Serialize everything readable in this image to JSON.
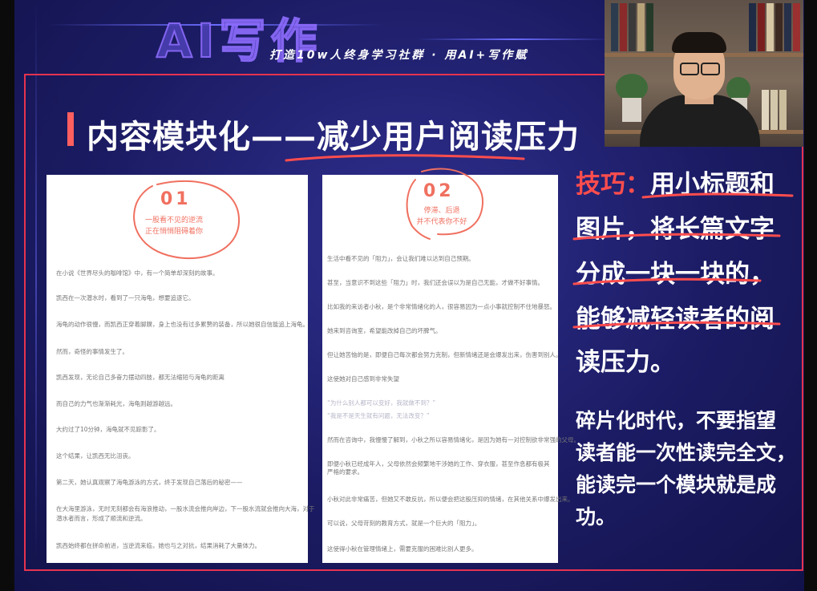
{
  "header": {
    "logo_text": "AI写作",
    "slogan": "打造10w人终身学习社群 · 用AI+写作赋"
  },
  "slide": {
    "title": "内容模块化——减少用户阅读压力",
    "cards": [
      {
        "number": "01",
        "badge_line1": "一股看不见的逆流",
        "badge_line2": "正在悄悄阻碍着你",
        "paragraphs": [
          "在小说《世界尽头的咖啡馆》中，有一个简单却深刻的故事。",
          "凯西在一次潜水时，看到了一只海龟，想要追逐它。",
          "海龟的动作很慢，而凯西正穿着脚蹼，身上也没有过多累赘的装备，所以她很自信能追上海龟。",
          "然而，奇怪的事情发生了。",
          "凯西发现，无论自己多奋力摆动四肢，都无法缩短与海龟的距离",
          "而自己的力气也渐渐耗光，海龟则越游越远。",
          "大约过了10分钟，海龟就不见踪影了。",
          "这个结果，让凯西无比沮丧。",
          "第二天，她认真观察了海龟游泳的方式，终于发现自己落后的秘密——",
          "在大海里游泳，无时无刻都会有海浪推动，一股水流会推向岸边，下一股水流就会推向大海，对于",
          "潜水者而言，形成了顺流和逆流。",
          "凯西始终都在拼命前进，当逆流来临，她也与之对抗，结果消耗了大量体力。"
        ]
      },
      {
        "number": "02",
        "badge_line1": "停滞、后退",
        "badge_line2": "并不代表你不好",
        "paragraphs": [
          "生活中看不见的「阻力」，会让我们难以达到自己预期。",
          "甚至，当意识不到这些「阻力」时，我们还会误以为是自己无能，才做不好事情。",
          "比如我的来访者小秋，是个非常情绪化的人，很容易因为一点小事就控制不住地暴怒。",
          "她来到咨询室，希望能改掉自己的坏脾气。",
          "但让她苦恼的是，即便自己每次都会努力克制，但新情绪还是会爆发出来，伤害到别人。",
          "这使她对自己感到非常失望",
          "“为什么别人都可以变好，我就做不到？”",
          "“我是不是天生就有问题，无法改变？”",
          "然而在咨询中，我慢慢了解到，小秋之所以容易情绪化，是因为她有一对控制欲非常强的父母。",
          "即便小秋已经成年人，父母依然会频繁地干涉她的工作、穿衣服，甚至作息都有极其严格的要求。",
          "小秋对此非常痛苦，但她又不敢反抗，所以便会把这股压抑的情绪，在其他关系中爆发出来。",
          "可以说，父母苛刻的教育方式，就是一个巨大的「阻力」。",
          "这使得小秋在管理情绪上，需要克服的困难比别人更多。"
        ]
      }
    ],
    "tip": {
      "lines": [
        {
          "prefix": "技巧：",
          "text": "用小标题和"
        },
        {
          "prefix": "",
          "text": "图片，将长篇文字"
        },
        {
          "prefix": "",
          "text": "分成一块一块的，"
        },
        {
          "prefix": "",
          "text": "能够减轻读者的阅"
        },
        {
          "prefix": "",
          "text": "读压力。"
        }
      ]
    },
    "note": {
      "lines": [
        "碎片化时代，不要指望",
        "读者能一次性读完全文，",
        "能读完一个模块就是成",
        "功。"
      ]
    }
  },
  "colors": {
    "background": "#1b1b63",
    "accent_red": "#ff4d4d",
    "badge_coral": "#f07060",
    "frame": "#e6334f"
  }
}
